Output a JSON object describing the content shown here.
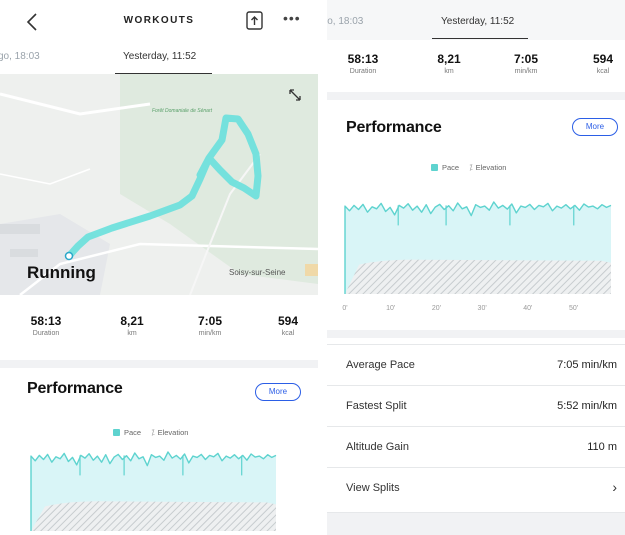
{
  "header": {
    "title": "WORKOUTS",
    "tabs": [
      {
        "label": "go, 18:03"
      },
      {
        "label": "Yesterday, 11:52"
      }
    ],
    "right_tabs": [
      {
        "label": "jo, 18:03"
      },
      {
        "label": "Yesterday, 11:52"
      }
    ]
  },
  "map": {
    "activity": "Running",
    "place": "Soisy-sur-Seine",
    "forest_label": "Forêt Domaniale de Sénart",
    "route_color": "#6fe0dc"
  },
  "stats": [
    {
      "value": "58:13",
      "label": "Duration"
    },
    {
      "value": "8,21",
      "label": "km"
    },
    {
      "value": "7:05",
      "label": "min/km"
    },
    {
      "value": "594",
      "label": "kcal"
    }
  ],
  "performance": {
    "title": "Performance",
    "more_label": "More",
    "legend": {
      "pace": "Pace",
      "elevation": "Elevation"
    }
  },
  "metrics": [
    {
      "label": "Average Pace",
      "value": "7:05 min/km"
    },
    {
      "label": "Fastest Split",
      "value": "5:52 min/km"
    },
    {
      "label": "Altitude Gain",
      "value": "110 m"
    },
    {
      "label": "View Splits",
      "value": ""
    }
  ],
  "chart_data": {
    "type": "area",
    "x_ticks": [
      "0'",
      "10'",
      "20'",
      "30'",
      "40'",
      "50'"
    ],
    "xlim": [
      0,
      58.2
    ],
    "series": [
      {
        "name": "Pace",
        "color": "#5ed3cf"
      },
      {
        "name": "Elevation",
        "color": "#bfc5c8"
      }
    ],
    "pace_profile": [
      0.88,
      0.74,
      0.9,
      0.78,
      0.93,
      0.7,
      0.86,
      0.8,
      0.96,
      0.72,
      0.84,
      0.62,
      0.9,
      0.82,
      0.95,
      0.76,
      0.88,
      0.7,
      0.92,
      0.66,
      0.85,
      0.93,
      0.78,
      0.89,
      0.74,
      0.97,
      0.8,
      0.86,
      0.6,
      0.92,
      0.84,
      0.88,
      0.76,
      1.0,
      0.82,
      0.9,
      0.79,
      0.94,
      0.68,
      0.88,
      0.84,
      0.93,
      0.78,
      0.9,
      0.86,
      0.96,
      0.74,
      0.88,
      0.82,
      0.92,
      0.8,
      0.9,
      0.76,
      0.94,
      0.85,
      0.88,
      0.8,
      0.92,
      0.84,
      0.9
    ],
    "colors": {
      "pace_fill": "#d9f5f7",
      "pace_line": "#5ed3cf",
      "elevation_hatch": "#c7cccf"
    }
  }
}
